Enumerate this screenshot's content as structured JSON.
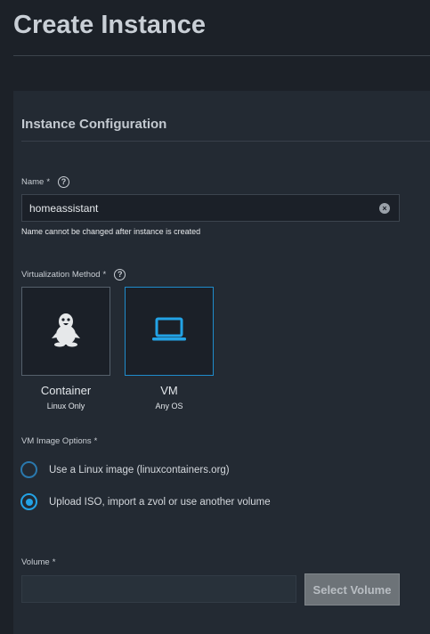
{
  "page": {
    "title": "Create Instance"
  },
  "section": {
    "title": "Instance Configuration"
  },
  "name_field": {
    "label": "Name",
    "required_marker": "*",
    "value": "homeassistant",
    "hint": "Name cannot be changed after instance is created"
  },
  "virtualization": {
    "label": "Virtualization Method",
    "required_marker": "*",
    "options": [
      {
        "name": "Container",
        "subtitle": "Linux Only",
        "icon": "linux-penguin-icon",
        "selected": false
      },
      {
        "name": "VM",
        "subtitle": "Any OS",
        "icon": "laptop-icon",
        "selected": true
      }
    ]
  },
  "vm_image": {
    "label": "VM Image Options",
    "required_marker": "*",
    "options": [
      {
        "label": "Use a Linux image (linuxcontainers.org)",
        "checked": false
      },
      {
        "label": "Upload ISO, import a zvol or use another volume",
        "checked": true
      }
    ]
  },
  "volume": {
    "label": "Volume",
    "required_marker": "*",
    "value": "",
    "button_label": "Select Volume"
  },
  "colors": {
    "background": "#1c2128",
    "card": "#232a33",
    "accent": "#23a3e6",
    "selected_border": "#1f8ccc"
  }
}
